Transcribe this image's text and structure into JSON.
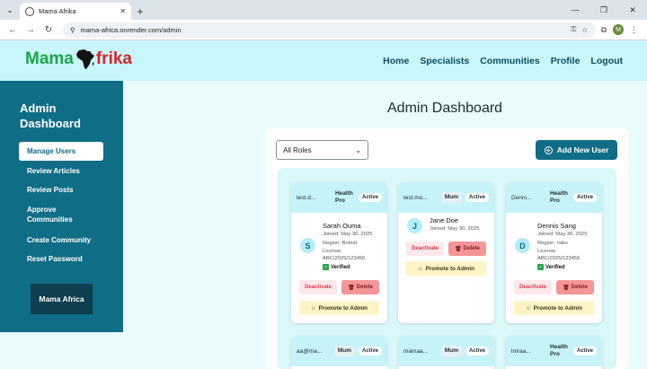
{
  "browser": {
    "tab_title": "Mama Afrika",
    "url": "mama-africa.onrender.com/admin",
    "profile_initial": "M"
  },
  "site": {
    "logo_left": "Mama",
    "logo_right": "frika",
    "nav": [
      "Home",
      "Specialists",
      "Communities",
      "Profile",
      "Logout"
    ]
  },
  "sidebar": {
    "title": "Admin Dashboard",
    "items": [
      "Manage Users",
      "Review Articles",
      "Review Posts",
      "Approve Communities",
      "Create Community",
      "Reset Password"
    ],
    "active_item": "Manage Users",
    "brand": "Mama Africa"
  },
  "main": {
    "title": "Admin Dashboard",
    "role_filter": "All Roles",
    "add_button": "Add New User"
  },
  "cards": [
    {
      "email": "test.d...",
      "role": "Health Pro",
      "status": "Active",
      "initial": "S",
      "name": "Sarah Ouma",
      "joined": "Joined: May 30, 2025",
      "region": "Region: Bomet",
      "license": "License: ABC/2025/123456",
      "verified": "Verified",
      "deactivate": "Deactivate",
      "delete": "Delete",
      "promote": "Promote to Admin"
    },
    {
      "email": "test.mo...",
      "role": "Mum",
      "status": "Active",
      "initial": "J",
      "name": "Jane Doe",
      "joined": "Joined: May 30, 2025",
      "deactivate": "Deactivate",
      "delete": "Delete",
      "promote": "Promote to Admin"
    },
    {
      "email": "Denni...",
      "role": "Health Pro",
      "status": "Active",
      "initial": "D",
      "name": "Dennis Sang",
      "joined": "Joined: May 30, 2025",
      "region": "Region: naks",
      "license": "License: ABC/2025/123456",
      "verified": "Verified",
      "deactivate": "Deactivate",
      "delete": "Delete",
      "promote": "Promote to Admin"
    },
    {
      "email": "aa@ma...",
      "role": "Mum",
      "status": "Active"
    },
    {
      "email": "mamaa...",
      "role": "Mum",
      "status": "Active"
    },
    {
      "email": "lmraa...",
      "role": "Health Pro",
      "status": "Active"
    }
  ]
}
